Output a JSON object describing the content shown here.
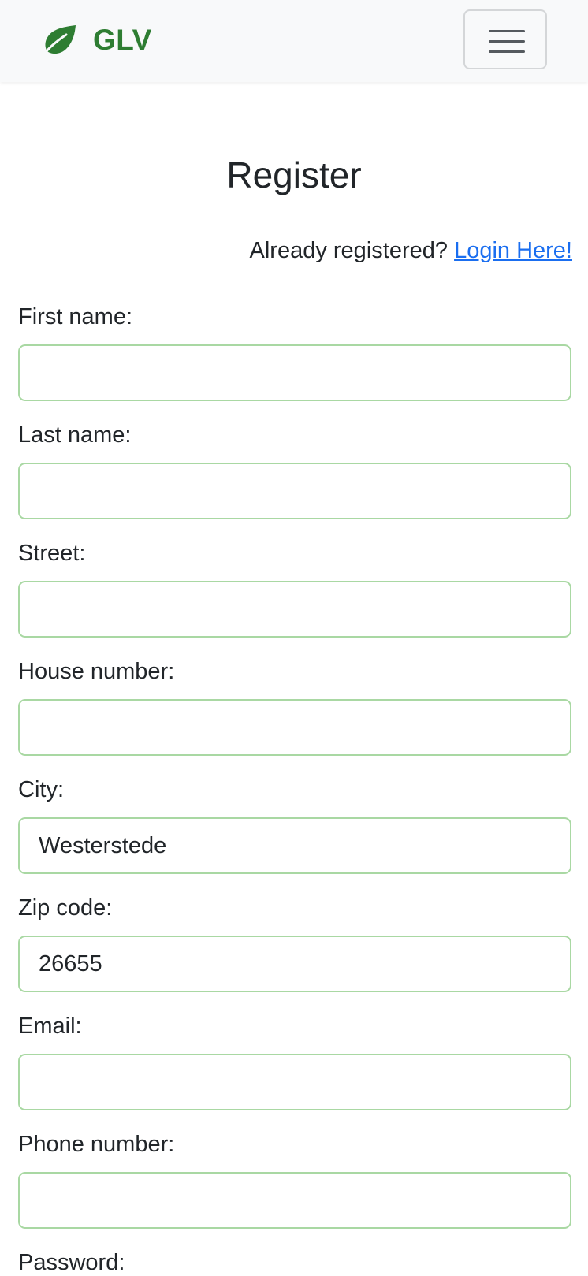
{
  "header": {
    "brand_text": "GLV",
    "brand_color": "#2e7d32",
    "logo_icon": "leaf-icon",
    "menu_icon": "hamburger-menu-icon"
  },
  "page": {
    "title": "Register",
    "already_text": "Already registered?",
    "login_link": "Login Here!",
    "link_color": "#1a6ef0",
    "input_border_color": "#a9d8a3"
  },
  "form": {
    "fields": [
      {
        "label": "First name:",
        "value": ""
      },
      {
        "label": "Last name:",
        "value": ""
      },
      {
        "label": "Street:",
        "value": ""
      },
      {
        "label": "House number:",
        "value": ""
      },
      {
        "label": "City:",
        "value": "Westerstede"
      },
      {
        "label": "Zip code:",
        "value": "26655"
      },
      {
        "label": "Email:",
        "value": ""
      },
      {
        "label": "Phone number:",
        "value": ""
      },
      {
        "label": "Password:",
        "value": ""
      }
    ]
  }
}
